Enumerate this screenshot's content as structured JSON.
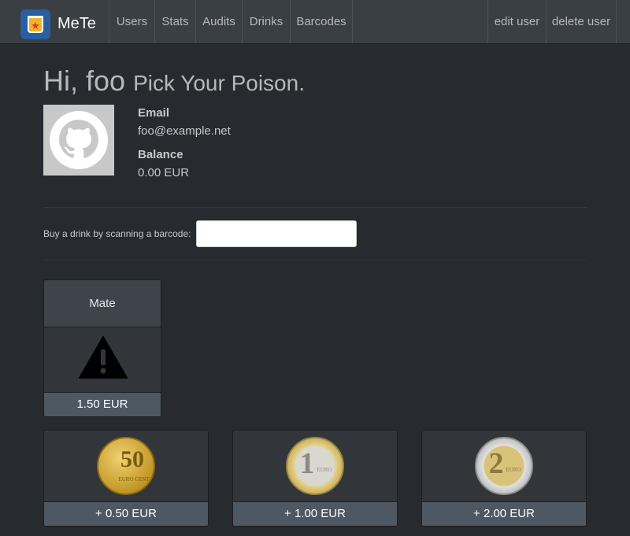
{
  "navbar": {
    "brand": "MeTe",
    "items": [
      "Users",
      "Stats",
      "Audits",
      "Drinks",
      "Barcodes"
    ],
    "right_items": [
      "edit user",
      "delete user"
    ]
  },
  "header": {
    "greeting": "Hi, foo",
    "subtitle": "Pick Your Poison."
  },
  "user": {
    "email_label": "Email",
    "email": "foo@example.net",
    "balance_label": "Balance",
    "balance": "0.00 EUR"
  },
  "scan": {
    "label": "Buy a drink by scanning a barcode:",
    "value": ""
  },
  "drinks": [
    {
      "name": "Mate",
      "icon": "warning-icon",
      "price": "1.50 EUR"
    }
  ],
  "deposits": [
    {
      "coin": "50",
      "coin_text": "EURO CENT",
      "label": "+ 0.50 EUR"
    },
    {
      "coin": "1",
      "coin_text": "EURO",
      "label": "+ 1.00 EUR"
    },
    {
      "coin": "2",
      "coin_text": "EURO",
      "label": "+ 2.00 EUR"
    }
  ],
  "colors": {
    "background": "#272b30",
    "navbar": "#3a3f44",
    "card_footer": "#4e5862"
  }
}
